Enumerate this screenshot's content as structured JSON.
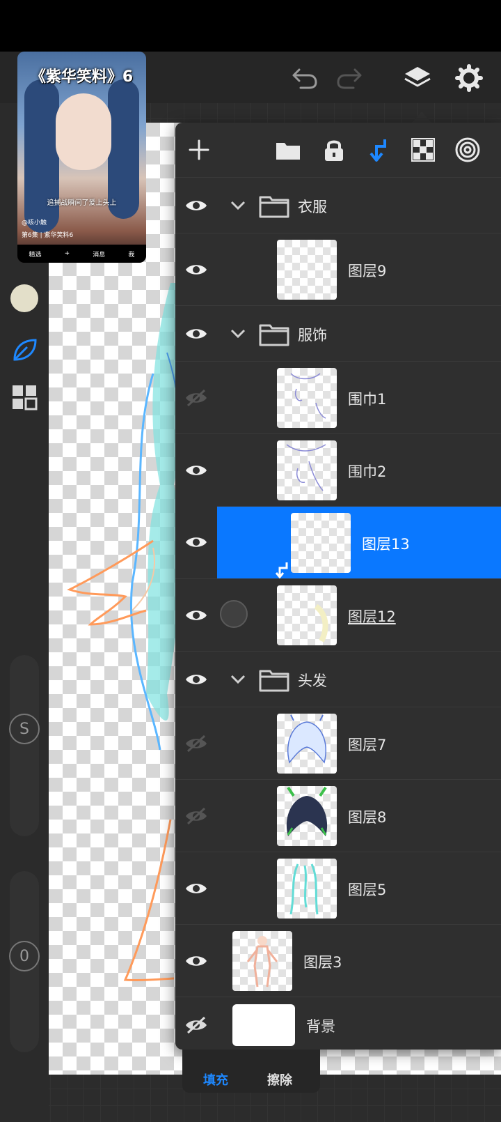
{
  "video_overlay": {
    "title": "《紫华笑料》6",
    "subtitle": "追捕战瞬间了爱上头上",
    "author": "@咳小触",
    "episode": "第6集 | 紫华笑料6",
    "nav": [
      "精选",
      "+",
      "消息",
      "我"
    ]
  },
  "toolbar": {
    "undo_icon": "undo-icon",
    "redo_icon": "redo-icon",
    "layers_icon": "layers-icon",
    "settings_icon": "gear-icon"
  },
  "left_rail": {
    "color": "#e3dfc9",
    "size_label": "S",
    "opacity_label": "0"
  },
  "layers_toolbar": {
    "add_icon": "plus-icon",
    "folder_icon": "folder-icon",
    "lock_icon": "lock-icon",
    "clip_icon": "clip-arrow-icon",
    "alpha_icon": "checker-icon",
    "blend_icon": "blend-icon"
  },
  "layers": [
    {
      "type": "folder",
      "name": "衣服",
      "visible": true
    },
    {
      "type": "layer",
      "name": "图层9",
      "visible": true
    },
    {
      "type": "folder",
      "name": "服饰",
      "visible": true
    },
    {
      "type": "layer",
      "name": "围巾1",
      "visible": false
    },
    {
      "type": "layer",
      "name": "围巾2",
      "visible": true
    },
    {
      "type": "layer",
      "name": "图层13",
      "visible": true,
      "selected": true,
      "clipped": true
    },
    {
      "type": "layer",
      "name": "图层12",
      "visible": true
    },
    {
      "type": "folder",
      "name": "头发",
      "visible": true
    },
    {
      "type": "layer",
      "name": "图层7",
      "visible": false
    },
    {
      "type": "layer",
      "name": "图层8",
      "visible": false
    },
    {
      "type": "layer",
      "name": "图层5",
      "visible": true
    },
    {
      "type": "layer",
      "name": "图层3",
      "visible": true
    },
    {
      "type": "layer",
      "name": "背景",
      "visible": false
    }
  ],
  "bottom_tabs": {
    "fill": "填充",
    "erase": "擦除"
  },
  "colors": {
    "accent": "#0a78ff",
    "panel": "#2f2f2f"
  }
}
